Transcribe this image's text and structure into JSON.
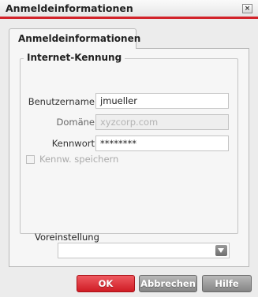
{
  "window": {
    "title": "Anmeldeinformationen",
    "close_glyph": "×"
  },
  "tab": {
    "label": "Anmeldeinformationen"
  },
  "group": {
    "title": "Internet-Kennung"
  },
  "form": {
    "username_label": "Benutzername",
    "username_value": "jmueller",
    "domain_label": "Domäne",
    "domain_value": "xyzcorp.com",
    "password_label": "Kennwort",
    "password_value": "********",
    "remember_label": "Kennw. speichern",
    "remember_checked": false
  },
  "preset": {
    "label": "Voreinstellung",
    "selected": ""
  },
  "buttons": {
    "ok": "OK",
    "cancel": "Abbrechen",
    "help": "Hilfe"
  },
  "colors": {
    "accent": "#d2232a",
    "panel": "#f6f6f6",
    "background": "#ececec"
  }
}
